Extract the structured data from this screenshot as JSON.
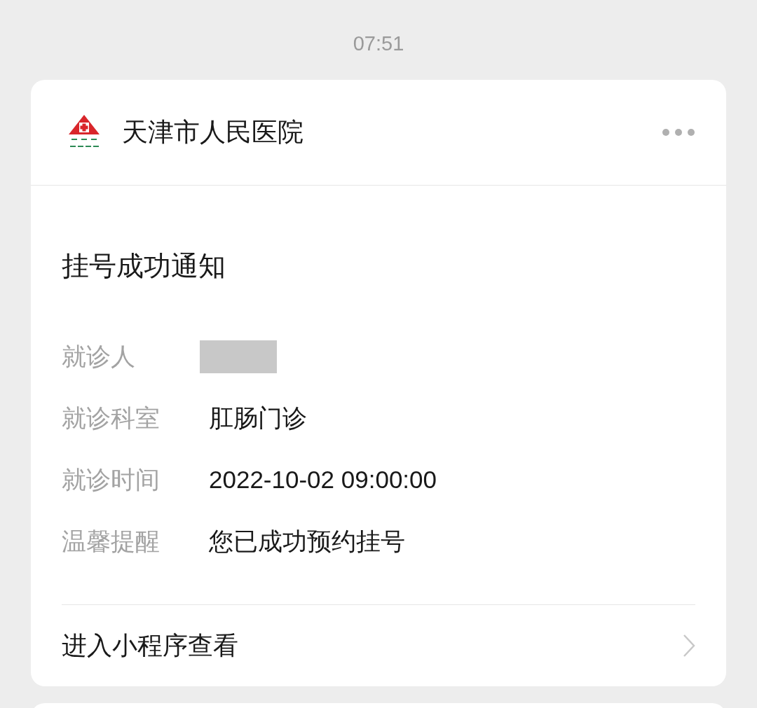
{
  "timestamp": "07:51",
  "card": {
    "sender": "天津市人民医院",
    "title": "挂号成功通知",
    "rows": [
      {
        "label": "就诊人",
        "kind": "redacted"
      },
      {
        "label": "就诊科室",
        "kind": "text",
        "value": "肛肠门诊"
      },
      {
        "label": "就诊时间",
        "kind": "text",
        "value": "2022-10-02 09:00:00"
      },
      {
        "label": "温馨提醒",
        "kind": "text",
        "value": "您已成功预约挂号"
      }
    ],
    "link": "进入小程序查看"
  }
}
